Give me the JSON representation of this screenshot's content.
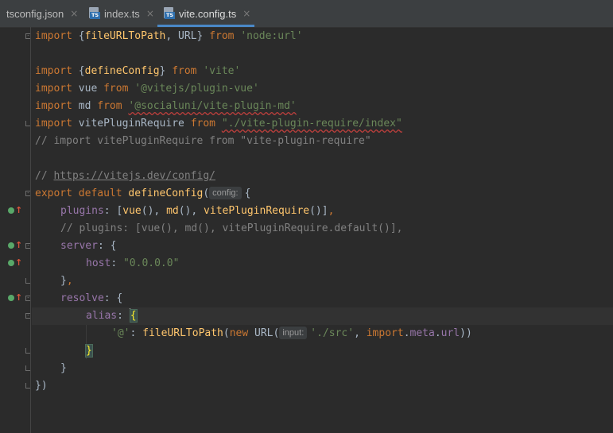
{
  "tabs": [
    {
      "label": "tsconfig.json",
      "icon": "json-file-icon",
      "active": false
    },
    {
      "label": "index.ts",
      "icon": "typescript-file-icon",
      "active": false
    },
    {
      "label": "vite.config.ts",
      "icon": "typescript-file-icon",
      "active": true
    }
  ],
  "ts_badge": "TS",
  "close_glyph": "×",
  "hints": {
    "config": "config:",
    "input": "input:"
  },
  "code": {
    "l1": {
      "kw": "import",
      "a": " {",
      "b": "fileURLToPath",
      "c": ", URL} ",
      "d": "from",
      "e": "'node:url'"
    },
    "l3": {
      "kw": "import",
      "a": " {",
      "b": "defineConfig",
      "c": "} ",
      "d": "from",
      "e": "'vite'"
    },
    "l4": {
      "kw": "import",
      "a": " vue ",
      "d": "from",
      "e": "'@vitejs/plugin-vue'"
    },
    "l5": {
      "kw": "import",
      "a": " md ",
      "d": "from",
      "e": "'@socialuni/vite-plugin-md'"
    },
    "l6": {
      "kw": "import",
      "a": " vitePluginRequire ",
      "d": "from",
      "e": "\"./vite-plugin-require/index\""
    },
    "l7": "// import vitePluginRequire from \"vite-plugin-require\"",
    "l9": {
      "prefix": "// ",
      "link": "https://vitejs.dev/config/"
    },
    "l10": {
      "kw1": "export",
      "kw2": "default",
      "fn": "defineConfig",
      "open": "(",
      "close": "{"
    },
    "l11": {
      "prop": "plugins",
      "a": ": [",
      "b": "vue",
      "c": "(), ",
      "d": "md",
      "e": "(), ",
      "f": "vitePluginRequire",
      "g": "()]",
      "h": ","
    },
    "l12": "// plugins: [vue(), md(), vitePluginRequire.default()],",
    "l13": {
      "prop": "server",
      "a": ": {"
    },
    "l14": {
      "prop": "host",
      "a": ": ",
      "str": "\"0.0.0.0\""
    },
    "l15": {
      "a": "}",
      "b": ","
    },
    "l16": {
      "prop": "resolve",
      "a": ": {"
    },
    "l17": {
      "prop": "alias",
      "a": ": ",
      "brace": "{"
    },
    "l18": {
      "str1": "'@'",
      "a": ": ",
      "fn": "fileURLToPath",
      "b": "(",
      "kw": "new",
      "c": " URL(",
      "str2": "'./src'",
      "d": ", ",
      "kw2": "import",
      "e": ".",
      "meta": "meta",
      "f": ".",
      "url": "url",
      "g": "))"
    },
    "l19": {
      "brace": "}"
    },
    "l20": "}",
    "l21": "})"
  }
}
